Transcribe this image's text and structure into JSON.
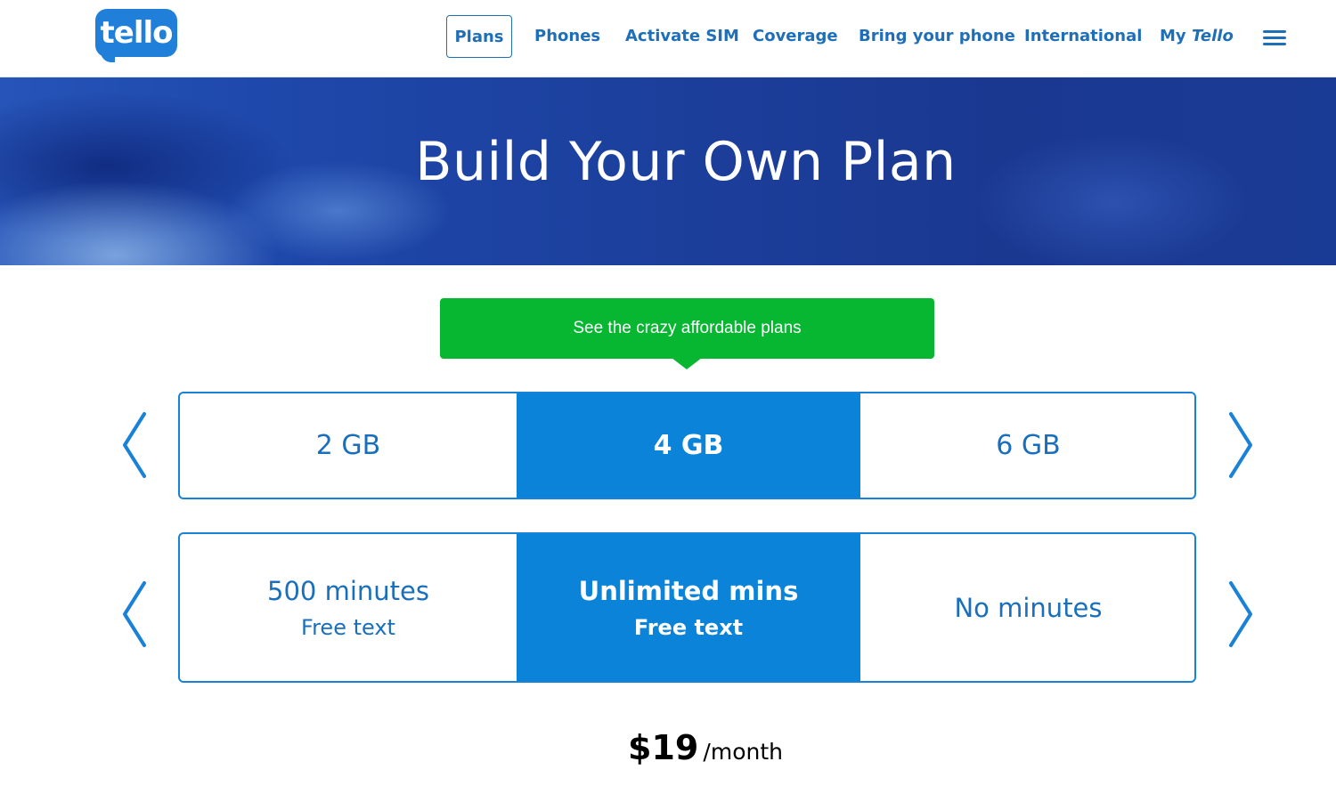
{
  "brand": {
    "logo_text": "tello",
    "color": "#1f7fd9"
  },
  "nav": {
    "items": [
      {
        "label": "Plans",
        "active": true
      },
      {
        "label": "Phones"
      },
      {
        "label": "Activate SIM"
      },
      {
        "label": "Coverage"
      },
      {
        "label": "Bring your phone"
      },
      {
        "label": "International"
      }
    ],
    "my_tello": {
      "prefix": "My",
      "brand": "Tello"
    },
    "menu_icon": "hamburger-icon"
  },
  "hero": {
    "title": "Build Your Own Plan"
  },
  "banner": {
    "text": "See the crazy affordable plans",
    "color": "#07b631"
  },
  "data_selector": {
    "options": [
      "2 GB",
      "4 GB",
      "6 GB"
    ],
    "selected_index": 1,
    "prev_icon": "chevron-left-icon",
    "next_icon": "chevron-right-icon"
  },
  "minutes_selector": {
    "options": [
      {
        "main": "500 minutes",
        "sub": "Free text"
      },
      {
        "main": "Unlimited mins",
        "sub": "Free text"
      },
      {
        "main": "No minutes",
        "sub": ""
      }
    ],
    "selected_index": 1,
    "prev_icon": "chevron-left-icon",
    "next_icon": "chevron-right-icon"
  },
  "price": {
    "amount": "$19",
    "unit": "/month"
  },
  "colors": {
    "accent": "#0a83d8",
    "nav_text": "#1e6fb8"
  }
}
